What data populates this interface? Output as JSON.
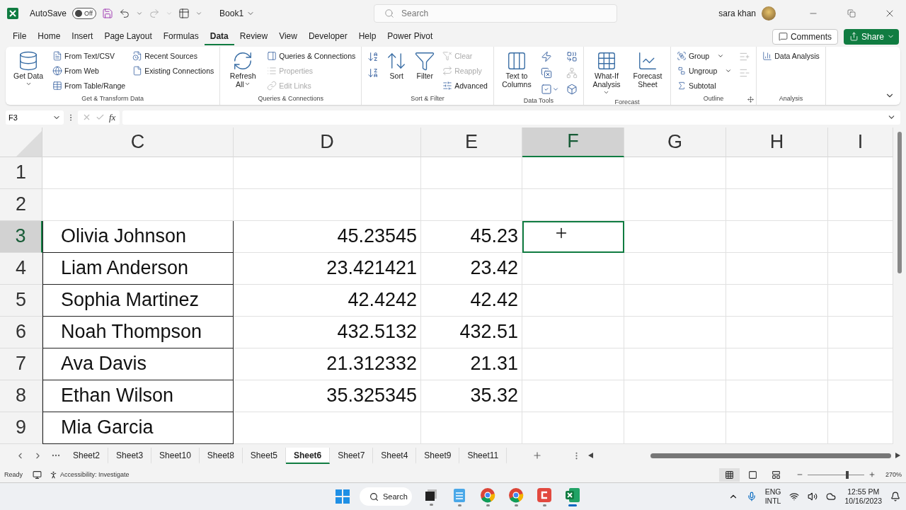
{
  "title_bar": {
    "autosave_label": "AutoSave",
    "autosave": {
      "on": false,
      "label": "Off"
    },
    "document": "Book1",
    "search": {
      "placeholder": "Search"
    },
    "user": "sara khan"
  },
  "menu": [
    {
      "label": "File",
      "selected": false
    },
    {
      "label": "Home",
      "selected": false
    },
    {
      "label": "Insert",
      "selected": false
    },
    {
      "label": "Page Layout",
      "selected": false
    },
    {
      "label": "Formulas",
      "selected": false
    },
    {
      "label": "Data",
      "selected": true
    },
    {
      "label": "Review",
      "selected": false
    },
    {
      "label": "View",
      "selected": false
    },
    {
      "label": "Developer",
      "selected": false
    },
    {
      "label": "Help",
      "selected": false
    },
    {
      "label": "Power Pivot",
      "selected": false
    }
  ],
  "actions": {
    "comments": "Comments",
    "share": "Share"
  },
  "ribbon": [
    {
      "name": "Get & Transform Data",
      "launcher": false,
      "columns": [
        [
          {
            "kind": "large",
            "label": "Get Data",
            "dropdown": true,
            "disabled": false
          }
        ],
        [
          {
            "kind": "small",
            "label": "From Text/CSV",
            "dropdown": false,
            "disabled": false
          },
          {
            "kind": "small",
            "label": "From Web",
            "dropdown": false,
            "disabled": false
          },
          {
            "kind": "small",
            "label": "From Table/Range",
            "dropdown": false,
            "disabled": false
          }
        ],
        [
          {
            "kind": "small",
            "label": "Recent Sources",
            "dropdown": false,
            "disabled": false
          },
          {
            "kind": "small",
            "label": "Existing Connections",
            "dropdown": false,
            "disabled": false
          }
        ]
      ]
    },
    {
      "name": "Queries & Connections",
      "launcher": false,
      "columns": [
        [
          {
            "kind": "large",
            "label": "Refresh All",
            "dropdown": true,
            "disabled": false
          }
        ],
        [
          {
            "kind": "small",
            "label": "Queries & Connections",
            "dropdown": false,
            "disabled": false
          },
          {
            "kind": "small",
            "label": "Properties",
            "dropdown": false,
            "disabled": true
          },
          {
            "kind": "small",
            "label": "Edit Links",
            "dropdown": false,
            "disabled": true
          }
        ]
      ]
    },
    {
      "name": "Sort & Filter",
      "launcher": false,
      "columns": [
        [
          {
            "kind": "icon",
            "dropdown": false,
            "disabled": false
          },
          {
            "kind": "icon",
            "dropdown": false,
            "disabled": false
          }
        ],
        [
          {
            "kind": "large",
            "label": "Sort",
            "dropdown": false,
            "disabled": false
          }
        ],
        [
          {
            "kind": "large",
            "label": "Filter",
            "dropdown": false,
            "disabled": false
          }
        ],
        [
          {
            "kind": "small",
            "label": "Clear",
            "dropdown": false,
            "disabled": true
          },
          {
            "kind": "small",
            "label": "Reapply",
            "dropdown": false,
            "disabled": true
          },
          {
            "kind": "small",
            "label": "Advanced",
            "dropdown": false,
            "disabled": false
          }
        ]
      ]
    },
    {
      "name": "Data Tools",
      "launcher": false,
      "columns": [
        [
          {
            "kind": "large",
            "label": "Text to Columns",
            "dropdown": false,
            "disabled": false
          }
        ],
        [
          {
            "kind": "icon",
            "dropdown": false,
            "disabled": false
          },
          {
            "kind": "icon",
            "dropdown": false,
            "disabled": false
          },
          {
            "kind": "icon",
            "dropdown": true,
            "disabled": false
          }
        ],
        [
          {
            "kind": "icon",
            "dropdown": false,
            "disabled": false
          },
          {
            "kind": "icon",
            "dropdown": false,
            "disabled": true
          },
          {
            "kind": "icon",
            "dropdown": false,
            "disabled": false
          }
        ]
      ]
    },
    {
      "name": "Forecast",
      "launcher": false,
      "columns": [
        [
          {
            "kind": "large",
            "label": "What-If Analysis",
            "dropdown": true,
            "disabled": false
          }
        ],
        [
          {
            "kind": "large",
            "label": "Forecast Sheet",
            "dropdown": false,
            "disabled": false
          }
        ]
      ]
    },
    {
      "name": "Outline",
      "launcher": true,
      "columns": [
        [
          {
            "kind": "small",
            "label": "Group",
            "dropdown": true,
            "disabled": false
          },
          {
            "kind": "small",
            "label": "Ungroup",
            "dropdown": true,
            "disabled": false
          },
          {
            "kind": "small",
            "label": "Subtotal",
            "dropdown": false,
            "disabled": false
          }
        ],
        [
          {
            "kind": "icon",
            "dropdown": false,
            "disabled": true
          },
          {
            "kind": "icon",
            "dropdown": false,
            "disabled": true
          }
        ]
      ]
    },
    {
      "name": "Analysis",
      "launcher": false,
      "columns": [
        [
          {
            "kind": "small",
            "label": "Data Analysis",
            "dropdown": false,
            "disabled": false
          }
        ]
      ]
    }
  ],
  "formula_bar": {
    "name_box": "F3",
    "function_label": "fx"
  },
  "sheet": {
    "columns": [
      {
        "label": "C",
        "selected": false
      },
      {
        "label": "D",
        "selected": false
      },
      {
        "label": "E",
        "selected": false
      },
      {
        "label": "F",
        "selected": true
      },
      {
        "label": "G",
        "selected": false
      },
      {
        "label": "H",
        "selected": false
      },
      {
        "label": "I",
        "selected": false
      }
    ],
    "rows": [
      {
        "label": "1",
        "selected": false,
        "boxed": false
      },
      {
        "label": "2",
        "selected": false,
        "boxed": false
      },
      {
        "label": "3",
        "selected": true,
        "boxed": true,
        "name": "Olivia Johnson",
        "value": "45.23545",
        "rounded": "45.23"
      },
      {
        "label": "4",
        "selected": false,
        "boxed": true,
        "name": "Liam Anderson",
        "value": "23.421421",
        "rounded": "23.42"
      },
      {
        "label": "5",
        "selected": false,
        "boxed": true,
        "name": "Sophia Martinez",
        "value": "42.4242",
        "rounded": "42.42"
      },
      {
        "label": "6",
        "selected": false,
        "boxed": true,
        "name": "Noah Thompson",
        "value": "432.5132",
        "rounded": "432.51"
      },
      {
        "label": "7",
        "selected": false,
        "boxed": true,
        "name": "Ava Davis",
        "value": "21.312332",
        "rounded": "21.31"
      },
      {
        "label": "8",
        "selected": false,
        "boxed": true,
        "name": "Ethan Wilson",
        "value": "35.325345",
        "rounded": "35.32"
      },
      {
        "label": "9",
        "selected": false,
        "boxed": true,
        "name": "Mia Garcia"
      }
    ]
  },
  "sheet_tabs": [
    {
      "label": "Sheet2",
      "selected": false
    },
    {
      "label": "Sheet3",
      "selected": false
    },
    {
      "label": "Sheet10",
      "selected": false
    },
    {
      "label": "Sheet8",
      "selected": false
    },
    {
      "label": "Sheet5",
      "selected": false
    },
    {
      "label": "Sheet6",
      "selected": true
    },
    {
      "label": "Sheet7",
      "selected": false
    },
    {
      "label": "Sheet4",
      "selected": false
    },
    {
      "label": "Sheet9",
      "selected": false
    },
    {
      "label": "Sheet11",
      "selected": false
    }
  ],
  "status_bar": {
    "mode": "Ready",
    "accessibility": "Accessibility: Investigate",
    "zoom": {
      "level": 0.7,
      "reading": "270%"
    }
  },
  "taskbar": {
    "search": "Search",
    "apps": [
      {
        "kind": "taskview",
        "active": false
      },
      {
        "kind": "notepad",
        "active": false
      },
      {
        "kind": "browser",
        "active": false
      },
      {
        "kind": "browser",
        "active": false
      },
      {
        "kind": "recorder",
        "active": false
      },
      {
        "kind": "spreadsheet",
        "active": true
      }
    ],
    "language": [
      "ENG",
      "INTL"
    ],
    "time": "12:55 PM",
    "date": "10/16/2023"
  }
}
